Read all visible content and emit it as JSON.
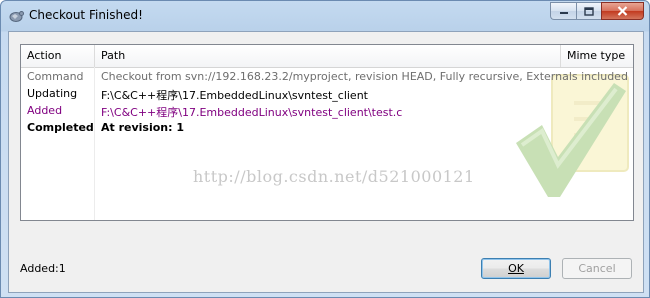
{
  "window": {
    "title": "Checkout Finished!"
  },
  "list": {
    "columns": [
      "Action",
      "Path",
      "Mime type"
    ],
    "rows": [
      {
        "action": "Command",
        "path": "Checkout from svn://192.168.23.2/myproject, revision HEAD, Fully recursive, Externals included",
        "color": "#6e6e6e",
        "bold": false
      },
      {
        "action": "Updating",
        "path": "F:\\C&C++程序\\17.EmbeddedLinux\\svntest_client",
        "color": "#000000",
        "bold": false
      },
      {
        "action": "Added",
        "path": "F:\\C&C++程序\\17.EmbeddedLinux\\svntest_client\\test.c",
        "color": "#800080",
        "bold": false
      },
      {
        "action": "Completed",
        "path": "At revision: 1",
        "color": "#000000",
        "bold": true
      }
    ],
    "watermark_text": "http://blog.csdn.net/d521000121"
  },
  "status": {
    "summary": "Added:1"
  },
  "buttons": {
    "ok_label": "OK",
    "cancel_label": "Cancel"
  },
  "colors": {
    "titlebar": "#b9d1ea",
    "added": "#800080",
    "command": "#6e6e6e"
  }
}
